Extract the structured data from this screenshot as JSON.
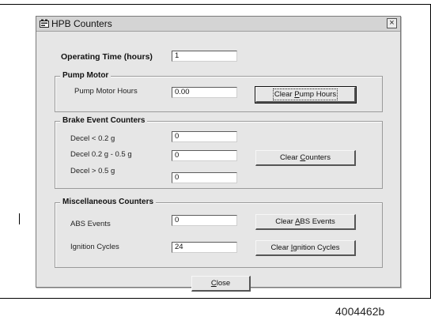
{
  "window": {
    "title": "HPB Counters",
    "icon": "hpb-app-icon",
    "close_glyph": "×"
  },
  "operating_time": {
    "label": "Operating Time (hours)",
    "value": "1"
  },
  "pump_motor": {
    "group_label": "Pump Motor",
    "hours_label": "Pump Motor Hours",
    "hours_value": "0.00",
    "clear_button": {
      "pre": "Clear ",
      "key": "P",
      "post": "ump Hours"
    }
  },
  "brake_events": {
    "group_label": "Brake Event Counters",
    "rows": [
      {
        "label": "Decel < 0.2 g",
        "value": "0"
      },
      {
        "label": "Decel  0.2 g - 0.5 g",
        "value": "0"
      },
      {
        "label": "Decel > 0.5 g",
        "value": "0"
      }
    ],
    "clear_button": {
      "pre": "Clear ",
      "key": "C",
      "post": "ounters"
    }
  },
  "misc": {
    "group_label": "Miscellaneous Counters",
    "abs_label": "ABS Events",
    "abs_value": "0",
    "abs_button": {
      "pre": "Clear ",
      "key": "A",
      "post": "BS Events"
    },
    "ignition_label": "Ignition Cycles",
    "ignition_value": "24",
    "ignition_button": {
      "pre": "Clear ",
      "key": "I",
      "post": "gnition Cycles"
    }
  },
  "close_button": {
    "pre": "",
    "key": "C",
    "post": "lose"
  },
  "figure_code": "4004462b"
}
